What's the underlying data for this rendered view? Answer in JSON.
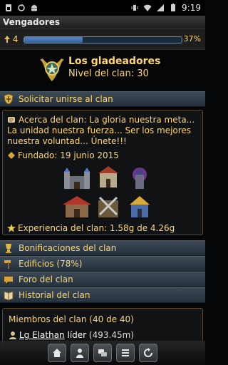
{
  "status_bar": {
    "time": "9:19",
    "left_icons": [
      "sim-icon",
      "sync-icon",
      "android-icon"
    ],
    "right_icons": [
      "vibrate-icon",
      "wifi-icon",
      "signal-icon",
      "battery-icon"
    ]
  },
  "title": "Vengadores",
  "level_row": {
    "level": "4",
    "progress_percent": 37,
    "progress_label": "37%"
  },
  "clan": {
    "name": "Los gladeadores",
    "level_text": "Nivel del clan: 30"
  },
  "actions": {
    "request_join": "Solicitar unirse al clan"
  },
  "about": {
    "text": "Acerca del clan: La gloria nuestra meta... La unidad nuestra fuerza... Ser los mejores nuestra voluntad... Únete!!!",
    "founded": "Fundado: 19 junio 2015",
    "experience": "Experiencia del clan: 1.58g de 4.26g"
  },
  "menu": {
    "bonuses": "Bonificaciones del clan",
    "buildings": "Edificios (78%)",
    "forum": "Foro del clan",
    "history": "Historial del clan"
  },
  "members": {
    "title": "Miembros del clan (40 de 40)",
    "list": [
      {
        "name": "Lg Elathan",
        "role": "líder",
        "power": "(493.45m)"
      }
    ]
  },
  "colors": {
    "gold_text": "#ffd66b",
    "row_bg": "#2f3c48",
    "panel_border": "#5c4a2a",
    "progress_fill": "#4a78b4"
  },
  "bottom_nav": [
    "home-icon",
    "profile-icon",
    "chat-icon",
    "list-icon",
    "refresh-icon"
  ]
}
